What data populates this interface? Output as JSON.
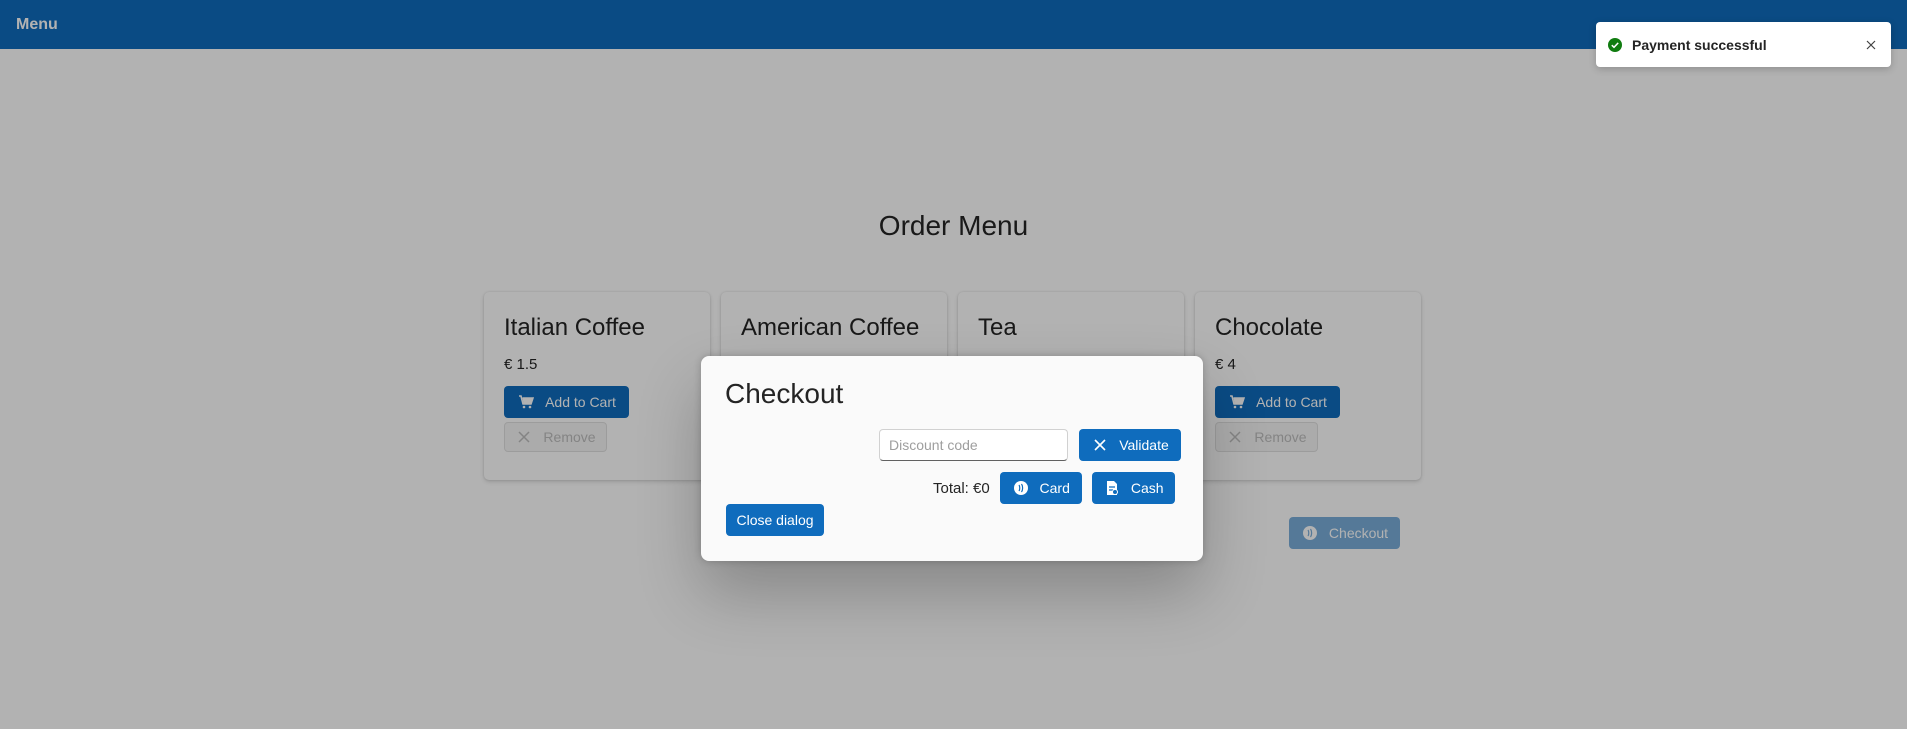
{
  "topbar": {
    "title": "Menu"
  },
  "page": {
    "title": "Order Menu"
  },
  "products": [
    {
      "name": "Italian Coffee",
      "price": "€ 1.5",
      "add_label": "Add to Cart",
      "remove_label": "Remove"
    },
    {
      "name": "American Coffee",
      "price": "",
      "add_label": "",
      "remove_label": ""
    },
    {
      "name": "Tea",
      "price": "",
      "add_label": "",
      "remove_label": ""
    },
    {
      "name": "Chocolate",
      "price": "€ 4",
      "add_label": "Add to Cart",
      "remove_label": "Remove"
    }
  ],
  "checkout_button": {
    "label": "Checkout"
  },
  "dialog": {
    "title": "Checkout",
    "discount_placeholder": "Discount code",
    "validate_label": "Validate",
    "total_text": "Total: €0",
    "card_label": "Card",
    "cash_label": "Cash",
    "close_label": "Close dialog"
  },
  "toast": {
    "message": "Payment successful"
  },
  "colors": {
    "brand": "#0f6cbd",
    "success": "#107c10",
    "overlay": "rgba(0,0,0,0.30)"
  },
  "icons": {
    "cart": "cart-icon",
    "remove": "close-icon",
    "card": "contactless-icon",
    "cash": "receipt-icon",
    "success": "checkmark-circle-icon"
  }
}
